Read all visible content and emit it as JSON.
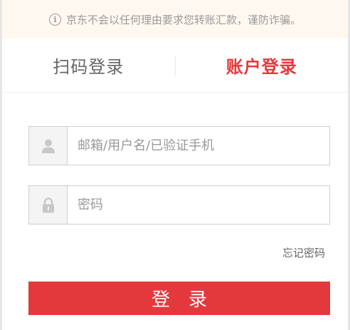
{
  "notice": {
    "icon": "info-icon",
    "text": "京东不会以任何理由要求您转账汇款，谨防诈骗。"
  },
  "tabs": {
    "qr_login": "扫码登录",
    "account_login": "账户登录",
    "active": "account_login"
  },
  "form": {
    "username": {
      "icon": "user-icon",
      "value": "",
      "placeholder": "邮箱/用户名/已验证手机"
    },
    "password": {
      "icon": "lock-icon",
      "value": "",
      "placeholder": "密码"
    },
    "forgot_label": "忘记密码",
    "submit_label": "登录"
  },
  "colors": {
    "accent": "#e4393c",
    "notice_bg": "#fff8f0",
    "icon_bg": "#f4f4f4",
    "border": "#cfcfcf"
  }
}
